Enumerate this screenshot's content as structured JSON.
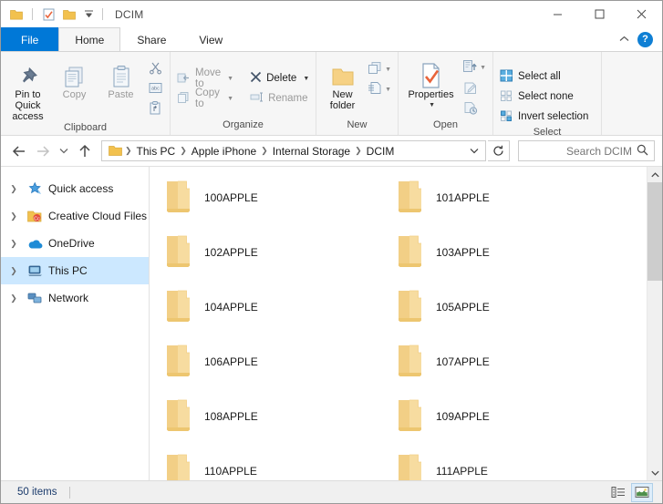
{
  "window": {
    "title": "DCIM",
    "quick_access_toolbar": [
      {
        "name": "folder-icon",
        "label": "Folder"
      },
      {
        "name": "properties-icon",
        "label": "Properties"
      },
      {
        "name": "new-folder-icon",
        "label": "New folder"
      },
      {
        "name": "customize-qat-icon",
        "label": "Customize Quick Access Toolbar"
      }
    ],
    "caption_buttons": [
      {
        "name": "minimize-button",
        "label": "Minimize",
        "glyph": "─"
      },
      {
        "name": "maximize-button",
        "label": "Maximize",
        "glyph": "□"
      },
      {
        "name": "close-button",
        "label": "Close",
        "glyph": "✕"
      }
    ]
  },
  "tabs": [
    {
      "id": "file",
      "label": "File"
    },
    {
      "id": "home",
      "label": "Home"
    },
    {
      "id": "share",
      "label": "Share"
    },
    {
      "id": "view",
      "label": "View"
    }
  ],
  "tab_right": {
    "collapse_label": "Minimize the Ribbon",
    "help_label": "?"
  },
  "ribbon": {
    "groups": [
      {
        "label": "Clipboard",
        "big_buttons": [
          {
            "name": "pin-to-quick-access-button",
            "label": "Pin to Quick\naccess",
            "line1": "Pin to Quick",
            "line2": "access",
            "enabled": true
          },
          {
            "name": "copy-button",
            "label": "Copy",
            "enabled": false
          },
          {
            "name": "paste-button",
            "label": "Paste",
            "enabled": false
          }
        ],
        "small_buttons": [
          {
            "name": "cut-button",
            "label": "Cut"
          },
          {
            "name": "copy-path-button",
            "label": "Copy path"
          },
          {
            "name": "paste-shortcut-button",
            "label": "Paste shortcut"
          }
        ]
      },
      {
        "label": "Organize",
        "items": [
          {
            "name": "move-to-button",
            "label": "Move to",
            "dropdown": true,
            "enabled": false
          },
          {
            "name": "delete-button",
            "label": "Delete",
            "dropdown": true,
            "enabled": true
          },
          {
            "name": "copy-to-button",
            "label": "Copy to",
            "dropdown": true,
            "enabled": false
          },
          {
            "name": "rename-button",
            "label": "Rename",
            "dropdown": false,
            "enabled": false
          }
        ]
      },
      {
        "label": "New",
        "big_buttons": [
          {
            "name": "new-folder-button",
            "line1": "New",
            "line2": "folder",
            "label": "New folder",
            "enabled": true
          }
        ],
        "small_buttons": [
          {
            "name": "new-item-button",
            "label": "New item"
          },
          {
            "name": "easy-access-button",
            "label": "Easy access"
          }
        ]
      },
      {
        "label": "Open",
        "big_buttons": [
          {
            "name": "properties-button",
            "label": "Properties",
            "enabled": true,
            "dropdown": true
          }
        ],
        "small_buttons": [
          {
            "name": "open-button",
            "label": "Open"
          },
          {
            "name": "edit-button",
            "label": "Edit"
          },
          {
            "name": "history-button",
            "label": "History"
          }
        ]
      },
      {
        "label": "Select",
        "items": [
          {
            "name": "select-all-button",
            "label": "Select all"
          },
          {
            "name": "select-none-button",
            "label": "Select none"
          },
          {
            "name": "invert-selection-button",
            "label": "Invert selection"
          }
        ]
      }
    ]
  },
  "address_bar": {
    "back_label": "Back",
    "forward_label": "Forward",
    "recent_label": "Recent locations",
    "up_label": "Up",
    "breadcrumbs": [
      "This PC",
      "Apple iPhone",
      "Internal Storage",
      "DCIM"
    ],
    "dropdown_label": "Previous locations",
    "refresh_label": "Refresh",
    "search_placeholder": "Search DCIM"
  },
  "nav_pane": {
    "items": [
      {
        "name": "sidebar-item-quick-access",
        "label": "Quick access",
        "icon": "star-icon",
        "selected": false
      },
      {
        "name": "sidebar-item-creative-cloud-files",
        "label": "Creative Cloud Files",
        "icon": "creative-cloud-icon",
        "selected": false
      },
      {
        "name": "sidebar-item-onedrive",
        "label": "OneDrive",
        "icon": "cloud-icon",
        "selected": false
      },
      {
        "name": "sidebar-item-this-pc",
        "label": "This PC",
        "icon": "computer-icon",
        "selected": true
      },
      {
        "name": "sidebar-item-network",
        "label": "Network",
        "icon": "network-icon",
        "selected": false
      }
    ]
  },
  "files": [
    {
      "name": "100APPLE",
      "type": "folder"
    },
    {
      "name": "101APPLE",
      "type": "folder"
    },
    {
      "name": "102APPLE",
      "type": "folder"
    },
    {
      "name": "103APPLE",
      "type": "folder"
    },
    {
      "name": "104APPLE",
      "type": "folder"
    },
    {
      "name": "105APPLE",
      "type": "folder"
    },
    {
      "name": "106APPLE",
      "type": "folder"
    },
    {
      "name": "107APPLE",
      "type": "folder"
    },
    {
      "name": "108APPLE",
      "type": "folder"
    },
    {
      "name": "109APPLE",
      "type": "folder"
    },
    {
      "name": "110APPLE",
      "type": "folder"
    },
    {
      "name": "111APPLE",
      "type": "folder"
    }
  ],
  "status_bar": {
    "item_count": "50 items",
    "view_buttons": [
      {
        "name": "details-view-button",
        "label": "Details view",
        "active": false
      },
      {
        "name": "large-icons-view-button",
        "label": "Large icons view",
        "active": true
      }
    ]
  },
  "colors": {
    "accent": "#0078d7",
    "selection": "#cce8ff",
    "folder": "#f5d283",
    "ribbon_bg": "#f6f6f6",
    "status_text": "#1a3a6b"
  }
}
